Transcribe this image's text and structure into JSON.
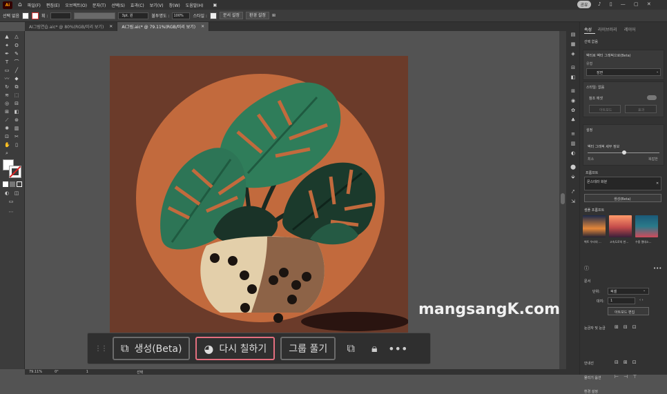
{
  "app": {
    "logo": "Ai",
    "brand_color": "#ff9a00"
  },
  "menu": [
    "파일(F)",
    "편집(E)",
    "오브젝트(O)",
    "문자(T)",
    "선택(S)",
    "효과(C)",
    "보기(V)",
    "창(W)",
    "도움말(H)"
  ],
  "share_label": "공유",
  "control": {
    "selection": "선택 없음",
    "stroke_label": "획 :",
    "brush": "3pt. 원",
    "opacity_label": "불투명도 :",
    "opacity_value": "100%",
    "style_label": "스타일 :",
    "doc_setup": "문서 설정",
    "prefs": "환경 설정"
  },
  "tabs": [
    {
      "label": "AI그림연습.aic* @ 80%(RGB/미리 보기)",
      "active": false
    },
    {
      "label": "AI그림.aic* @ 79.11%(RGB/미리 보기)",
      "active": true
    }
  ],
  "context_bar": {
    "generate": "생성(Beta)",
    "recolor": "다시 칠하기",
    "ungroup": "그룹 풀기",
    "highlight_color": "#e46f7f"
  },
  "watermark": "mangsangK.com",
  "status": {
    "zoom": "79.11%",
    "angle": "0°",
    "artboard": "1",
    "tool": "선택"
  },
  "panel": {
    "tabs": [
      "속성",
      "라이브러리",
      "레이어"
    ],
    "no_selection": "선택 없음",
    "vector": "벡터로 벡터 그래픽으로(Beta)",
    "type_label": "유형",
    "type_value": "장면",
    "style_label": "스타일: 없음",
    "ref_label": "참조 에셋",
    "ref_btn1": "아트보드",
    "ref_btn2": "효과",
    "settings": "설정",
    "detail_label": "벡터 그래픽 세부 정보",
    "min": "최소",
    "max": "복잡한",
    "prompt_label": "프롬프트",
    "prompt_value": "몬스테라 화분",
    "generate_btn": "생성(Beta)",
    "samples_label": "샘플 프롬프트",
    "samples": [
      "벽트 우리의 ...",
      "고속도로의 한...",
      "수중 열대소..."
    ],
    "doc_label": "문서",
    "unit_label": "단위:",
    "unit_value": "픽셀",
    "artboard_label": "대지:",
    "artboard_value": "1",
    "edit_artboard": "아트보드 편집",
    "rulers": "눈금자 및 눈금",
    "guides": "안내선",
    "snap": "물리기 옵션",
    "prefs": "환경 설정"
  }
}
